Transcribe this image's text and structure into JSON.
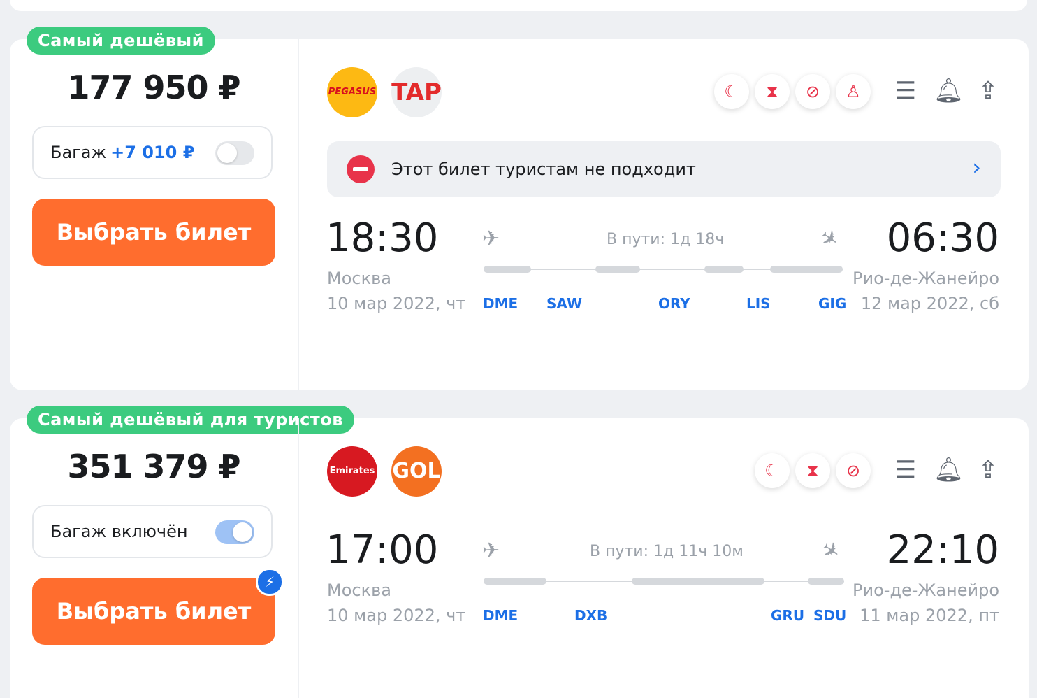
{
  "offers": [
    {
      "badge": "Самый дешёвый",
      "price": "177 950 ₽",
      "baggage": {
        "label": "Багаж",
        "addon": "+7 010 ₽",
        "toggle_on": false
      },
      "select_label": "Выбрать билет",
      "airlines": [
        {
          "name": "PEGASUS",
          "color": "#FDB913",
          "text_color": "#D8101E"
        },
        {
          "name": "TAP",
          "color": "#EDEFF1",
          "text_color": "#E32B2B"
        }
      ],
      "amenity_icons": [
        "moon-icon",
        "hourglass-icon",
        "no-baggage-icon",
        "flight-attendant-icon"
      ],
      "warning": "Этот билет туристам не подходит",
      "depart": {
        "time": "18:30",
        "city": "Москва",
        "date": "10 мар 2022, чт"
      },
      "arrive": {
        "time": "06:30",
        "city": "Рио-де-Жанейро",
        "date": "12 мар 2022, сб"
      },
      "duration": "В пути: 1д 18ч",
      "airports": [
        "DME",
        "SAW",
        "ORY",
        "LIS",
        "GIG"
      ]
    },
    {
      "badge": "Самый дешёвый для туристов",
      "price": "351 379 ₽",
      "baggage": {
        "label": "Багаж включён",
        "addon": "",
        "toggle_on": true
      },
      "select_label": "Выбрать билет",
      "airlines": [
        {
          "name": "Emirates",
          "color": "#D71921",
          "text_color": "#FFFFFF"
        },
        {
          "name": "GOL",
          "color": "#F37021",
          "text_color": "#FFFFFF"
        }
      ],
      "amenity_icons": [
        "moon-icon",
        "hourglass-icon",
        "no-baggage-icon"
      ],
      "depart": {
        "time": "17:00",
        "city": "Москва",
        "date": "10 мар 2022, чт"
      },
      "arrive": {
        "time": "22:10",
        "city": "Рио-де-Жанейро",
        "date": "11 мар 2022, пт"
      },
      "duration": "В пути: 1д 11ч 10м",
      "airports": [
        "DME",
        "DXB",
        "GRU",
        "SDU"
      ]
    }
  ],
  "colors": {
    "accent": "#1C6FE6",
    "cta": "#FF6D2E",
    "badge": "#3CCB7F",
    "alert": "#E8334A"
  }
}
